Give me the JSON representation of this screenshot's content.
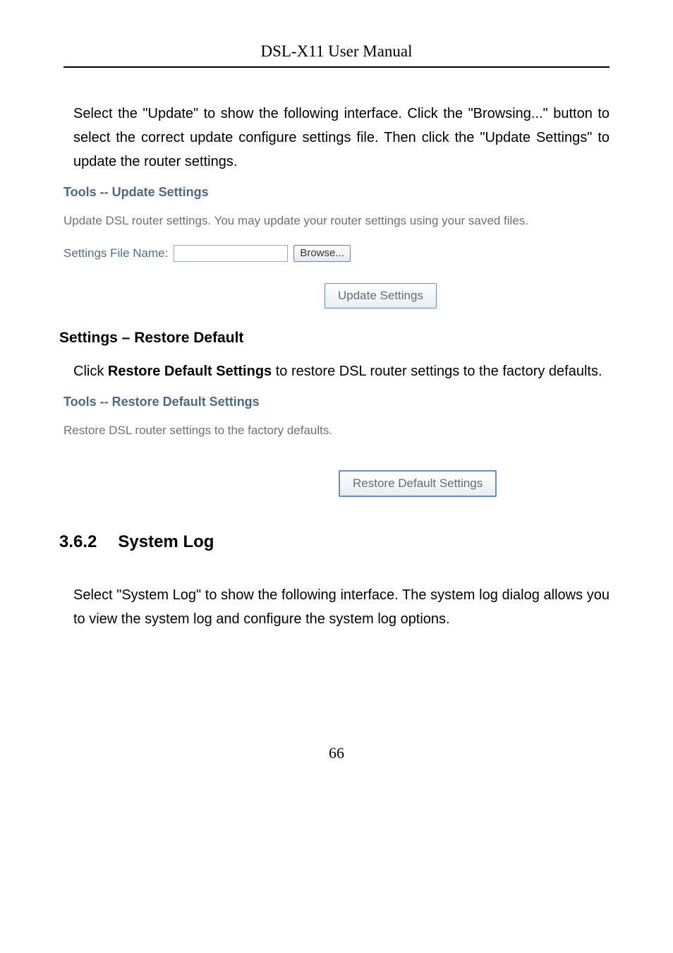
{
  "header": {
    "title": "DSL-X11 User Manual"
  },
  "intro": {
    "para1": "Select the \"Update\" to show the following interface. Click the \"Browsing...\" button to select the correct update configure settings file. Then click the \"Update Settings\" to update the router settings."
  },
  "update": {
    "title": "Tools -- Update Settings",
    "desc": "Update DSL router settings. You may update your router settings using your saved files.",
    "file_label": "Settings File Name:",
    "browse_label": "Browse...",
    "button_label": "Update Settings"
  },
  "restore_section": {
    "heading": "Settings – Restore Default",
    "para_pre": "Click ",
    "para_bold": "Restore Default Settings",
    "para_post": " to restore DSL router settings to the factory defaults."
  },
  "restore": {
    "title": "Tools -- Restore Default Settings",
    "desc": "Restore DSL router settings to the factory defaults.",
    "button_label": "Restore Default Settings"
  },
  "syslog": {
    "num": "3.6.2",
    "title": "System Log",
    "para": "Select \"System Log\" to show the following interface. The system log dialog allows you to view the system log and configure the system log options."
  },
  "pagenum": "66"
}
